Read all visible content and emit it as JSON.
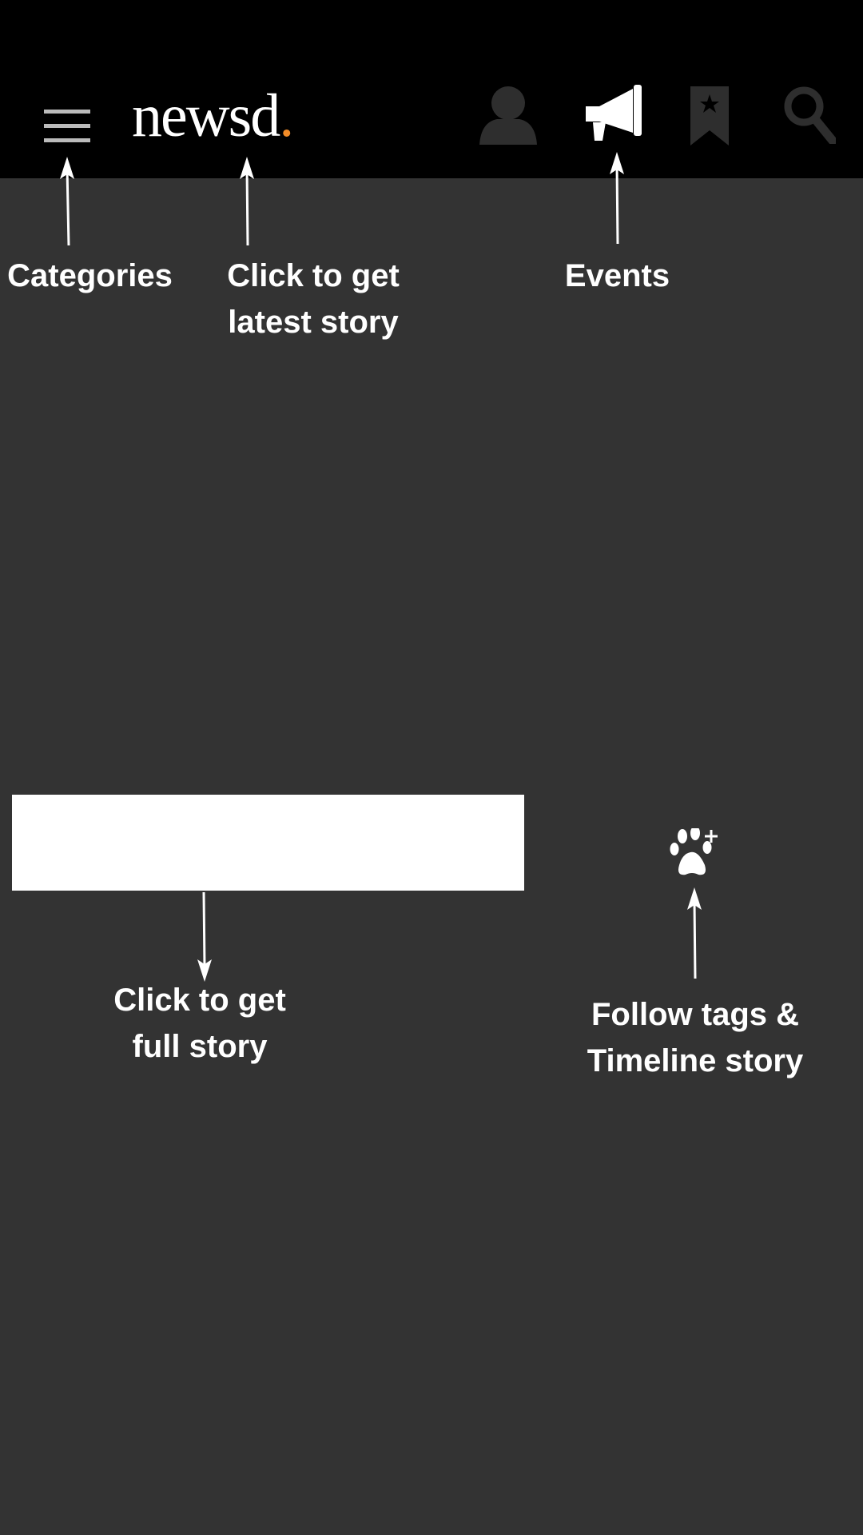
{
  "header": {
    "logo_text": "newsd",
    "logo_dot": ".",
    "icons": [
      "menu-icon",
      "user-icon",
      "megaphone-icon",
      "bookmark-icon",
      "search-icon"
    ]
  },
  "annotations": {
    "categories": "Categories",
    "latest_story_line1": "Click to get",
    "latest_story_line2": "latest story",
    "events": "Events",
    "full_story_line1": "Click to get",
    "full_story_line2": "full story",
    "follow_line1": "Follow tags &",
    "follow_line2": "Timeline story"
  },
  "colors": {
    "background": "#333333",
    "header": "#000000",
    "accent": "#f28c28",
    "icon_dim": "#2e2e2e",
    "icon_menu": "#bbbbbb"
  }
}
